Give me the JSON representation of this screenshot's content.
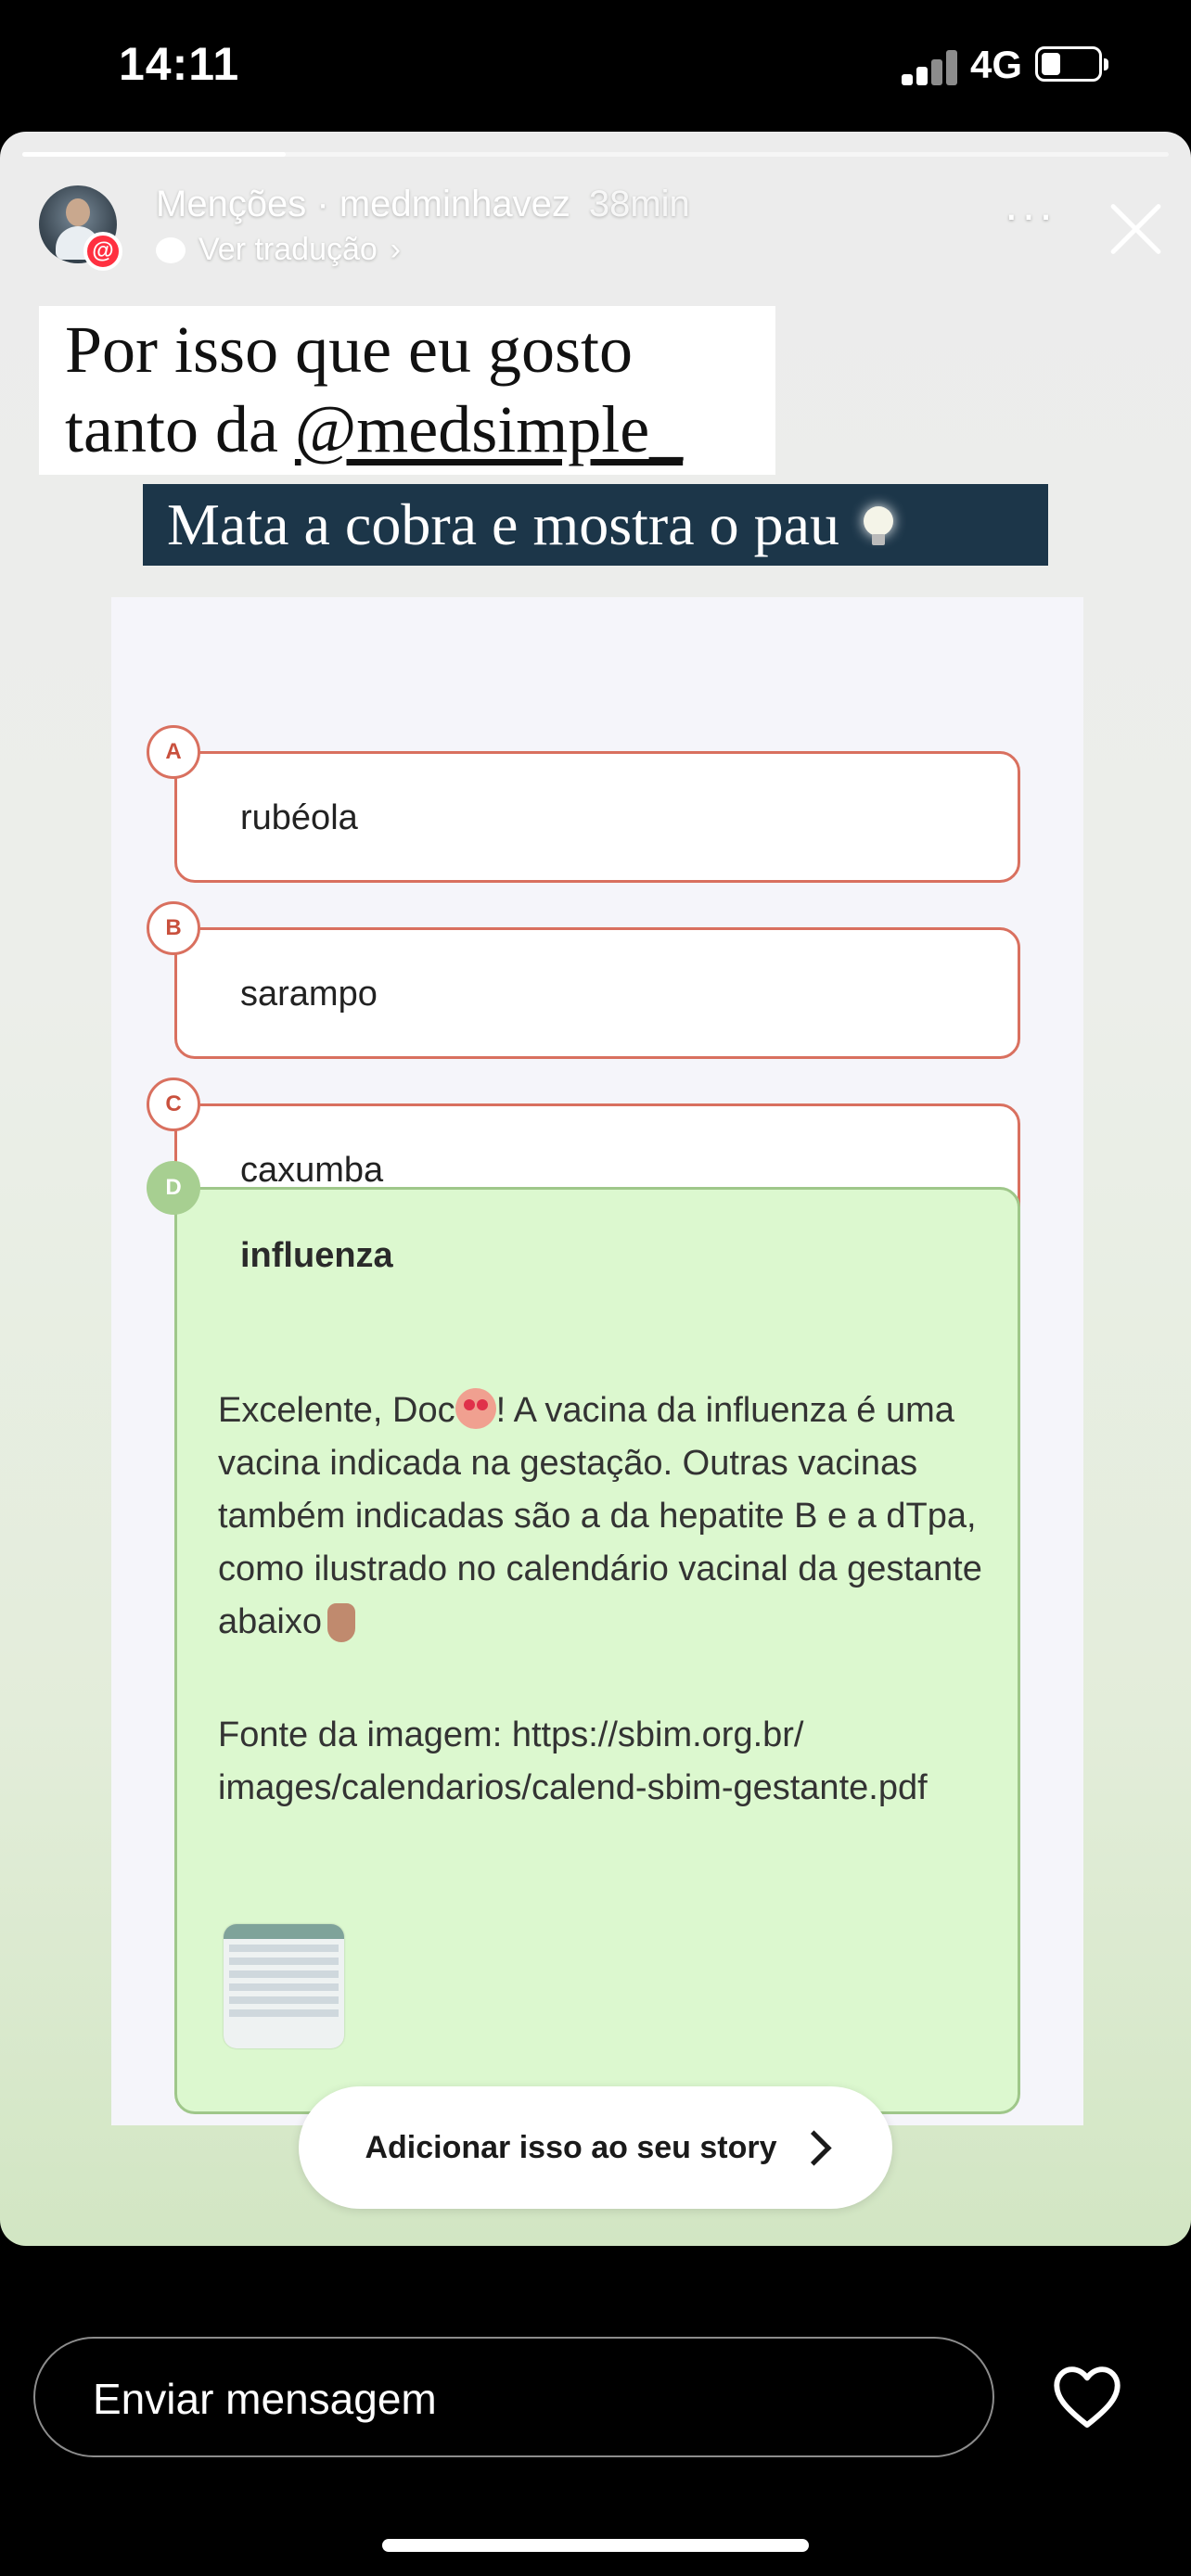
{
  "status_bar": {
    "time": "14:11",
    "network": "4G"
  },
  "story": {
    "progress_fraction": 0.23,
    "header": {
      "username": "Menções · medminhavez",
      "time_ago": "38min",
      "translate": "Ver tradução",
      "more": "···"
    },
    "caption1": {
      "line1": "Por isso que eu gosto",
      "line2_prefix": "tanto da ",
      "line2_handle": "@medsimple_"
    },
    "caption2": "Mata a cobra e mostra o pau",
    "mention_badge": "@",
    "options": [
      {
        "letter": "A",
        "text": "rubéola"
      },
      {
        "letter": "B",
        "text": "sarampo"
      },
      {
        "letter": "C",
        "text": "caxumba"
      }
    ],
    "correct": {
      "letter": "D",
      "text": "influenza",
      "exp_part1": "Excelente, Doc",
      "exp_part2": "! A vacina da influenza é uma vacina indicada na gestação. Outras vacinas também indicadas são a da hepatite B e a dTpa, como ilustrado no calendário vacinal da gestante abaixo",
      "source": "Fonte da imagem: https://sbim.org.br/ images/calendarios/calend-sbim-gestante.pdf"
    },
    "add_to_story": "Adicionar isso ao seu story"
  },
  "reply": {
    "placeholder": "Enviar mensagem"
  },
  "icons": [
    "signal-icon",
    "battery-icon",
    "bubble-icon",
    "more-icon",
    "close-icon",
    "bulb-icon",
    "chevron-right-icon",
    "heart-icon"
  ],
  "colors": {
    "option_border": "#d9705f",
    "correct_bg": "#dcf8cf",
    "correct_border": "#9fc78a",
    "caption_bg": "#1c3649"
  }
}
